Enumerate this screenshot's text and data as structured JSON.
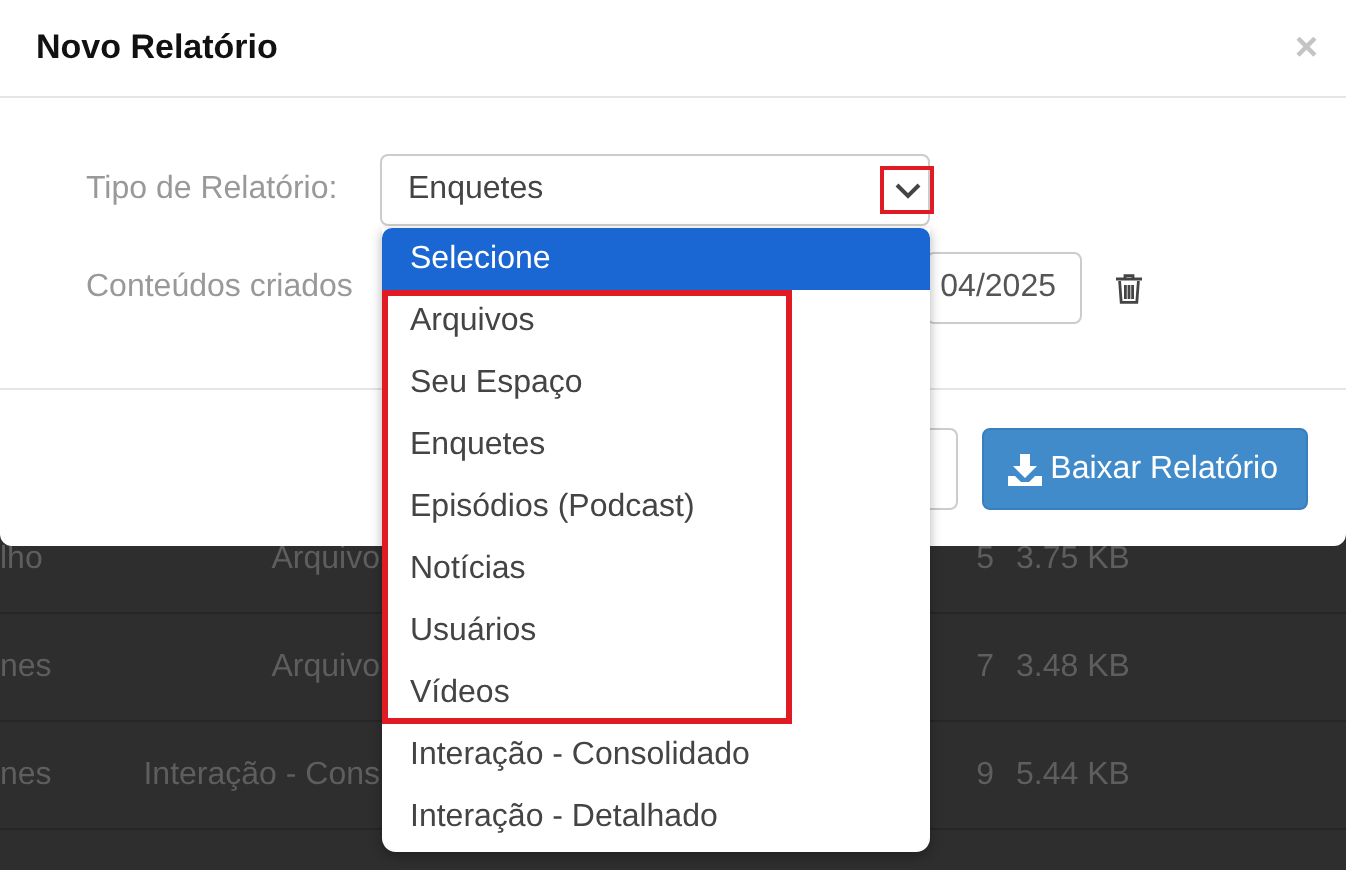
{
  "modal": {
    "title": "Novo Relatório",
    "close": "×",
    "fields": [
      {
        "label": "Tipo de Relatório:",
        "value": "Enquetes",
        "caret_highlighted": true
      },
      {
        "label": "Conteúdos criados",
        "value": "04/2025"
      }
    ],
    "dropdown": {
      "options": [
        {
          "label": "Selecione",
          "selected": true,
          "highlighted": false
        },
        {
          "label": "Arquivos",
          "selected": false,
          "highlighted": true
        },
        {
          "label": "Seu Espaço",
          "selected": false,
          "highlighted": true
        },
        {
          "label": "Enquetes",
          "selected": false,
          "highlighted": true
        },
        {
          "label": "Episódios (Podcast)",
          "selected": false,
          "highlighted": true
        },
        {
          "label": "Notícias",
          "selected": false,
          "highlighted": true
        },
        {
          "label": "Usuários",
          "selected": false,
          "highlighted": true
        },
        {
          "label": "Vídeos",
          "selected": false,
          "highlighted": true
        },
        {
          "label": "Interação - Consolidado",
          "selected": false,
          "highlighted": false
        },
        {
          "label": "Interação - Detalhado",
          "selected": false,
          "highlighted": false
        }
      ]
    },
    "download_button": "Baixar Relatório"
  },
  "table": {
    "rows": [
      [
        "lho",
        "Arquivo",
        "5",
        "3.75 KB"
      ],
      [
        "nes",
        "Arquivo",
        "7",
        "3.48 KB"
      ],
      [
        "nes",
        "Interação - Cons",
        "9",
        "5.44 KB"
      ]
    ]
  }
}
